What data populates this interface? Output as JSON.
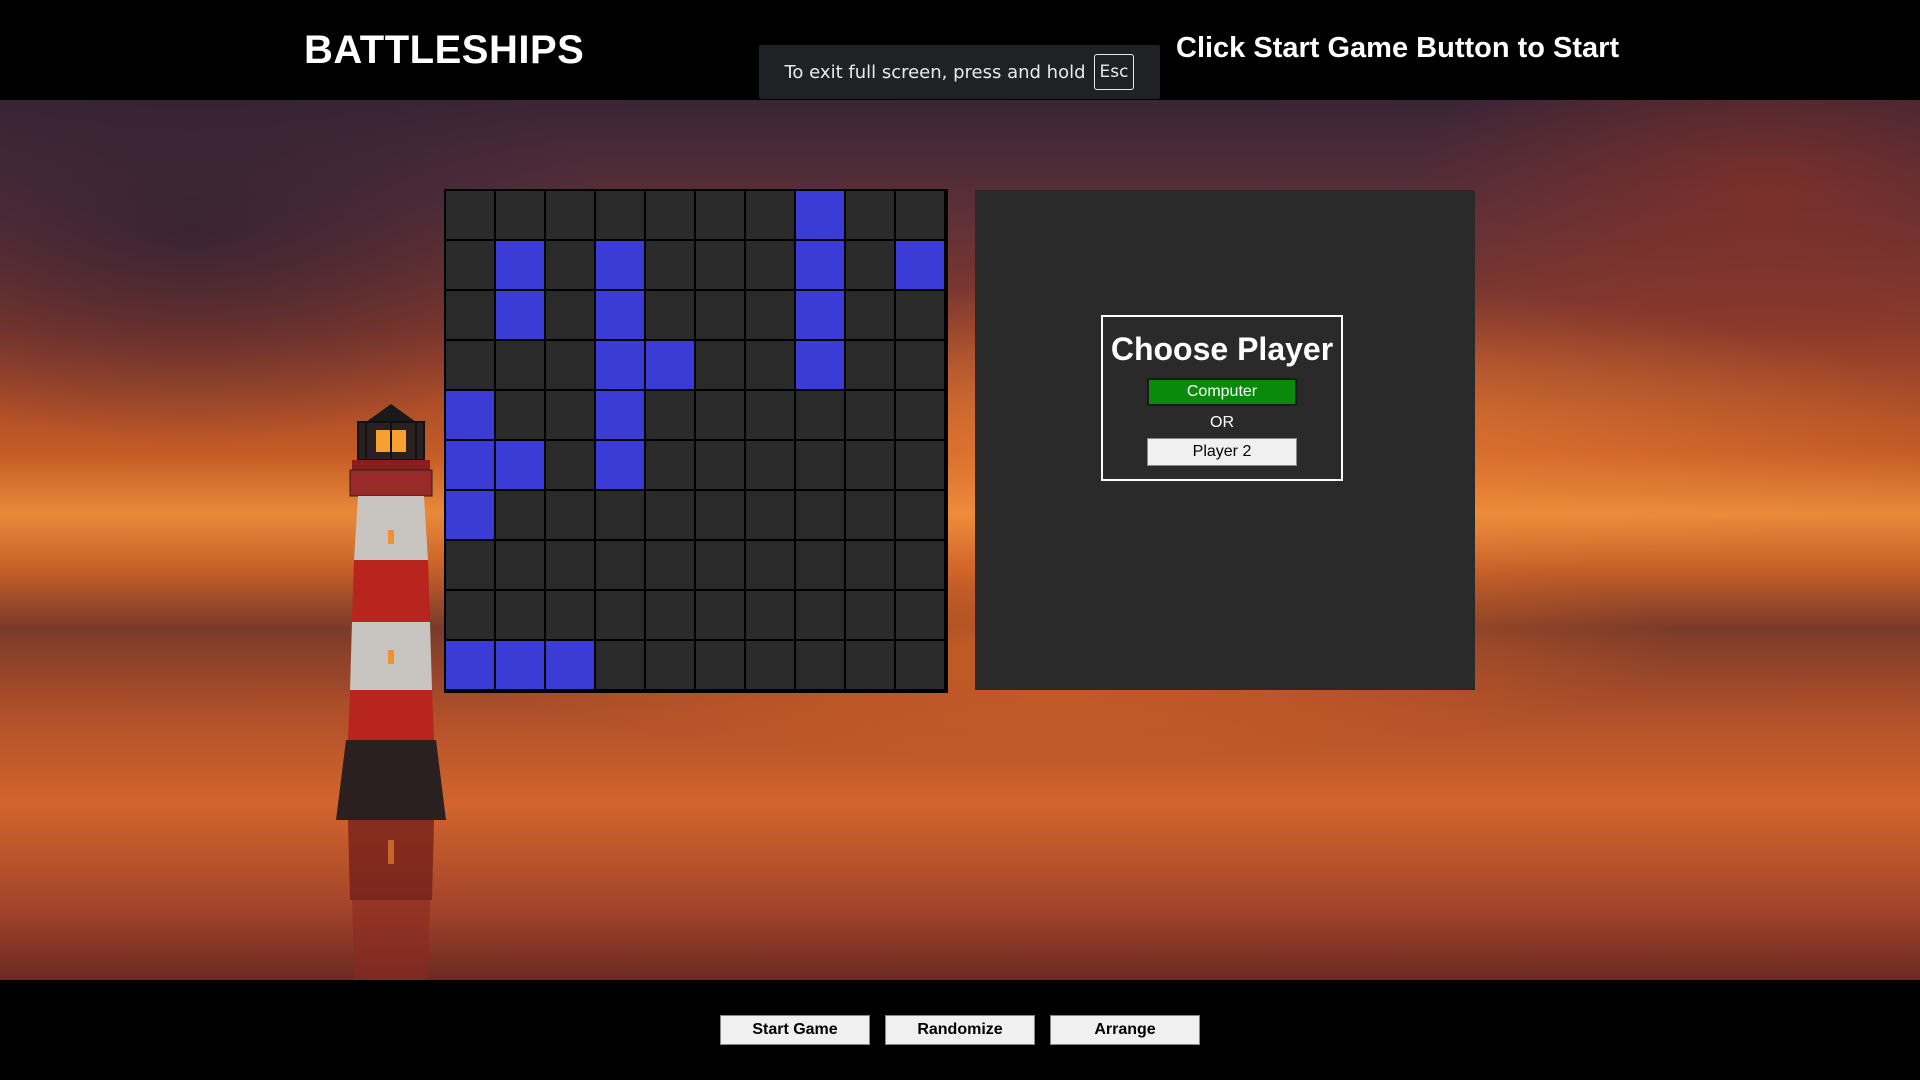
{
  "header": {
    "title": "BATTLESHIPS",
    "status": "Click Start Game Button to Start"
  },
  "fullscreen_notice": {
    "text": "To exit full screen, press and hold",
    "key": "Esc"
  },
  "board": {
    "rows": 10,
    "cols": 10,
    "ship_color": "#3b3bd6",
    "empty_color": "#2a2a2a",
    "cells": [
      [
        0,
        0,
        0,
        0,
        0,
        0,
        0,
        1,
        0,
        0
      ],
      [
        0,
        1,
        0,
        1,
        0,
        0,
        0,
        1,
        0,
        1
      ],
      [
        0,
        1,
        0,
        1,
        0,
        0,
        0,
        1,
        0,
        0
      ],
      [
        0,
        0,
        0,
        1,
        1,
        0,
        0,
        1,
        0,
        0
      ],
      [
        1,
        0,
        0,
        1,
        0,
        0,
        0,
        0,
        0,
        0
      ],
      [
        1,
        1,
        0,
        1,
        0,
        0,
        0,
        0,
        0,
        0
      ],
      [
        1,
        0,
        0,
        0,
        0,
        0,
        0,
        0,
        0,
        0
      ],
      [
        0,
        0,
        0,
        0,
        0,
        0,
        0,
        0,
        0,
        0
      ],
      [
        0,
        0,
        0,
        0,
        0,
        0,
        0,
        0,
        0,
        0
      ],
      [
        1,
        1,
        1,
        0,
        0,
        0,
        0,
        0,
        0,
        0
      ]
    ]
  },
  "choose_player": {
    "title": "Choose Player",
    "computer_label": "Computer",
    "or_label": "OR",
    "player2_label": "Player 2",
    "computer_color": "#0a8a0a"
  },
  "controls": {
    "start_label": "Start Game",
    "randomize_label": "Randomize",
    "arrange_label": "Arrange"
  }
}
